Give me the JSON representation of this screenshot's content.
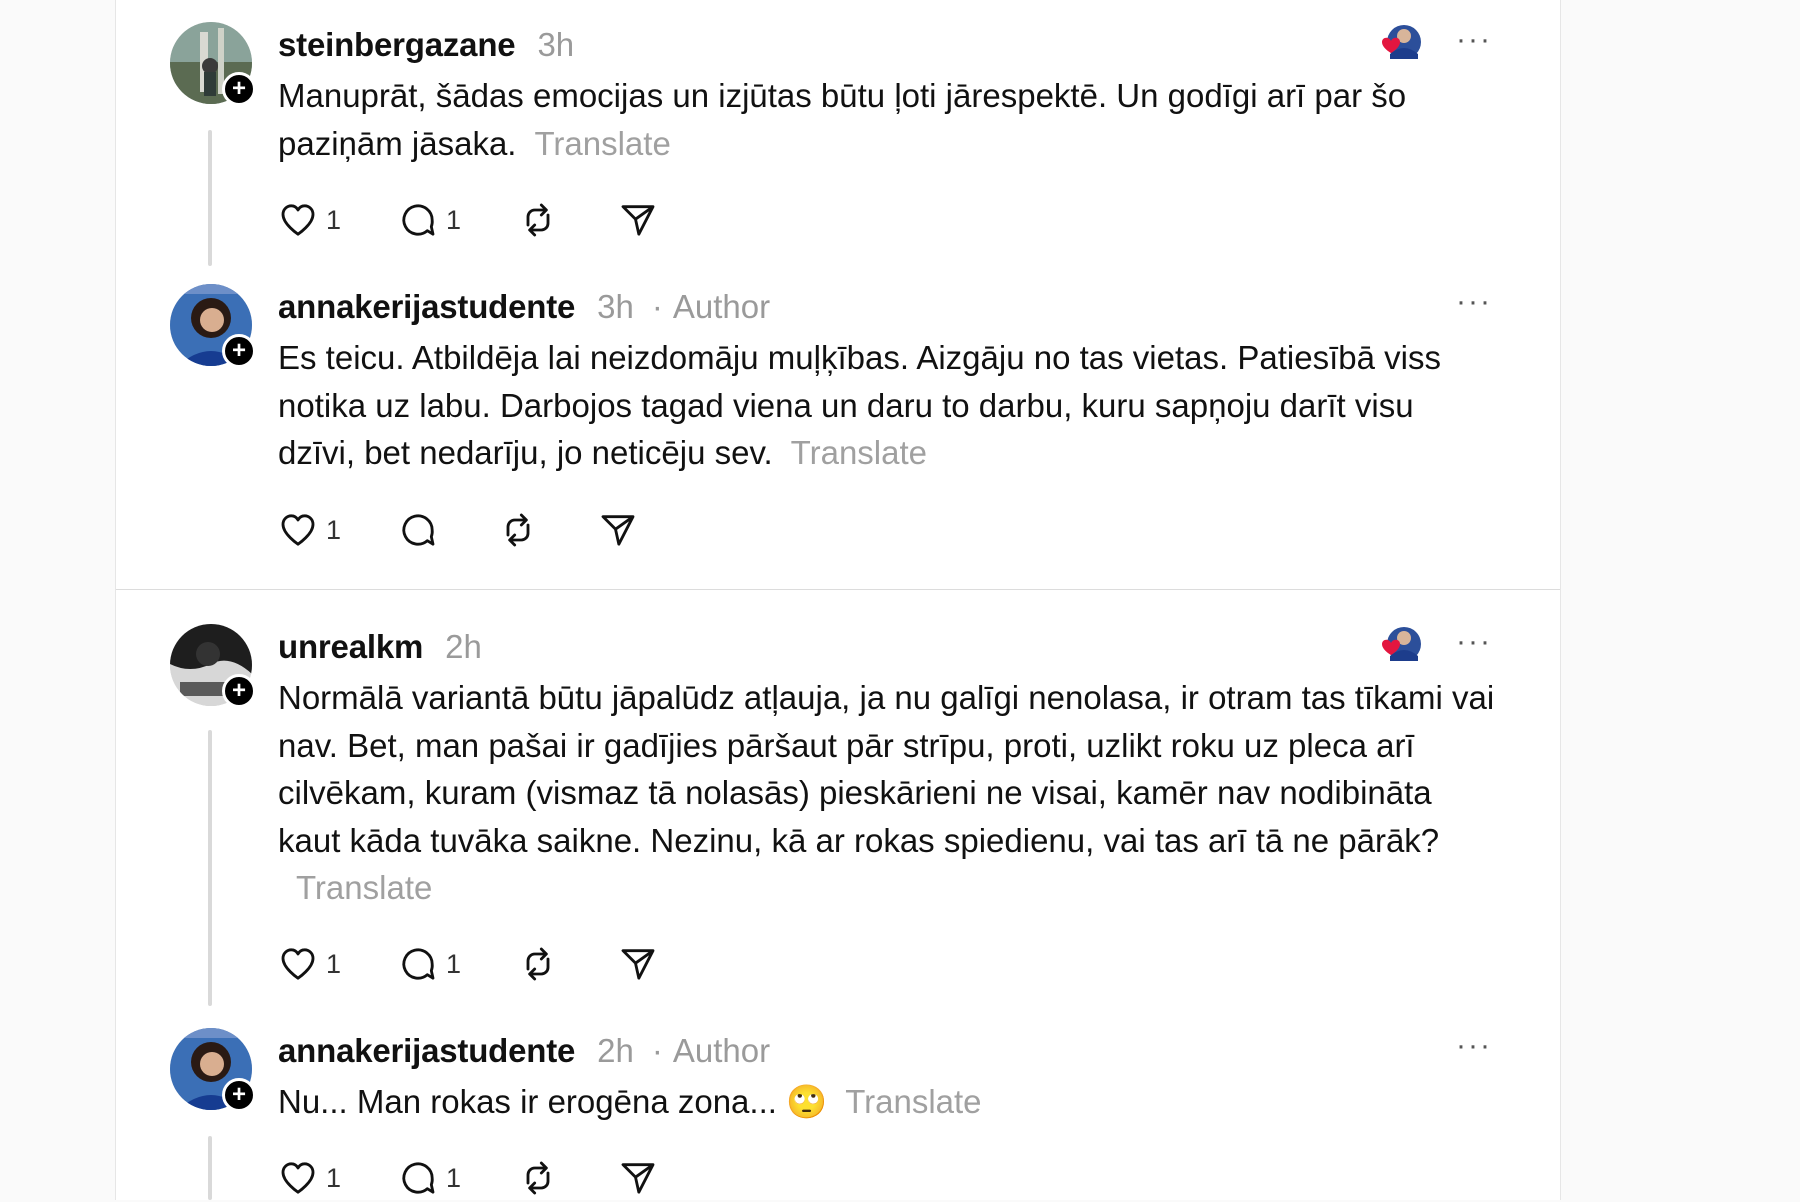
{
  "posts": [
    {
      "username": "steinbergazane",
      "time": "3h",
      "text": "Manuprāt, šādas emocijas un izjūtas būtu ļoti jārespektē. Un godīgi arī par šo paziņām jāsaka.",
      "translate": "Translate",
      "likes": "1",
      "replies": "1"
    },
    {
      "username": "annakerijastudente",
      "time": "3h",
      "separator": "·",
      "author": "Author",
      "text": "Es teicu. Atbildēja lai neizdomāju muļķības. Aizgāju no tas vietas. Patiesībā viss notika uz labu. Darbojos tagad viena un daru to darbu, kuru sapņoju darīt visu dzīvi, bet nedarīju, jo neticēju sev.",
      "translate": "Translate",
      "likes": "1"
    },
    {
      "username": "unrealkm",
      "time": "2h",
      "text": "Normālā variantā būtu jāpalūdz atļauja, ja nu galīgi nenolasa, ir otram tas tīkami vai nav. Bet, man pašai ir gadījies pāršaut pār strīpu, proti, uzlikt roku uz pleca arī cilvēkam, kuram (vismaz tā nolasās) pieskārieni ne visai, kamēr nav nodibināta kaut kāda tuvāka saikne. Nezinu, kā ar rokas spiedienu, vai tas arī tā ne pārāk?",
      "translate": "Translate",
      "likes": "1",
      "replies": "1"
    },
    {
      "username": "annakerijastudente",
      "time": "2h",
      "separator": "·",
      "author": "Author",
      "text": "Nu... Man rokas ir erogēna zona... 🙄",
      "translate": "Translate",
      "likes": "1",
      "replies": "1"
    }
  ],
  "ui": {
    "more_glyph": "···",
    "follow_glyph": "+"
  },
  "colors": {
    "like_heart": "#e3163f",
    "thread_line": "#d9d9d9",
    "muted_text": "#9a9a9a"
  },
  "icons": [
    "heart-icon",
    "comment-icon",
    "repost-icon",
    "share-icon",
    "more-icon",
    "plus-icon"
  ]
}
